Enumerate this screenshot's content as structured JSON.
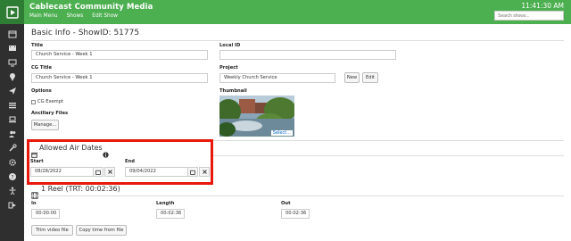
{
  "header": {
    "app_title": "Cablecast Community Media",
    "nav": [
      "Main Menu",
      "Shows",
      "Edit Show"
    ],
    "clock": "11:41:30 AM",
    "search_placeholder": "Search shows..."
  },
  "sidebar": {
    "icons": [
      "logo-play-icon",
      "calendar-icon",
      "film-icon",
      "monitor-icon",
      "award-icon",
      "send-icon",
      "list-icon",
      "laptop-icon",
      "users-icon",
      "wrench-icon",
      "gear-icon",
      "help-icon",
      "accessibility-icon",
      "signout-icon"
    ]
  },
  "basic_info": {
    "title": "Basic Info - ShowID: 51775",
    "title_label": "Title",
    "title_value": "Church Service - Week 1",
    "local_id_label": "Local ID",
    "local_id_value": "",
    "cg_title_label": "CG Title",
    "cg_title_value": "Church Service - Week 1",
    "project_label": "Project",
    "project_value": "Weekly Church Service",
    "new_label": "New",
    "edit_label": "Edit",
    "options_label": "Options",
    "cg_exempt_label": "CG Exempt",
    "thumbnail_label": "Thumbnail",
    "thumbnail_select": "Select...",
    "ancillary_label": "Ancillary Files",
    "manage_label": "Manage..."
  },
  "air_dates": {
    "title": "Allowed Air Dates",
    "start_label": "Start",
    "start_value": "08/28/2022",
    "end_label": "End",
    "end_value": "09/04/2022"
  },
  "reel": {
    "title": "1 Reel (TRT: 00:02:36)",
    "in_label": "In",
    "in_value": "00:00:00",
    "length_label": "Length",
    "length_value": "00:02:36",
    "out_label": "Out",
    "out_value": "00:02:36",
    "trim_label": "Trim video file",
    "copy_label": "Copy time from file"
  },
  "colors": {
    "topbar": "#4caf50",
    "sidebar": "#2f2f2f",
    "highlight": "#e8190c"
  }
}
